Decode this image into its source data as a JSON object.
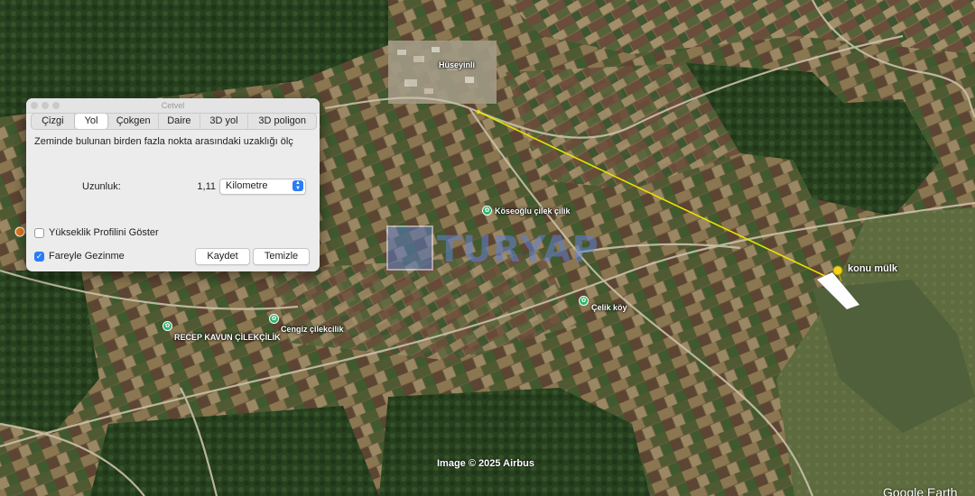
{
  "dialog": {
    "title": "Cetvel",
    "tabs": [
      {
        "label": "Çizgi",
        "active": false
      },
      {
        "label": "Yol",
        "active": true
      },
      {
        "label": "Çokgen",
        "active": false
      },
      {
        "label": "Daire",
        "active": false
      },
      {
        "label": "3D yol",
        "active": false
      },
      {
        "label": "3D poligon",
        "active": false
      }
    ],
    "description": "Zeminde bulunan birden fazla nokta arasındaki uzaklığı ölç",
    "length_label": "Uzunluk:",
    "length_value": "1,11",
    "unit": "Kilometre",
    "elevation_profile_label": "Yükseklik Profilini Göster",
    "elevation_profile_checked": false,
    "mouse_navigation_label": "Fareyle Gezinme",
    "mouse_navigation_checked": true,
    "save_label": "Kaydet",
    "clear_label": "Temizle"
  },
  "map": {
    "labels": {
      "village": "Hüseyinli",
      "kose": "Köseoğlu çilek çilik",
      "celik": "Çelik köy",
      "recep": "RECEP KAVUN ÇİLEKÇİLİK",
      "cengiz": "Cengiz çilekcilik",
      "property": "konu mülk"
    },
    "watermark": "TURYAP",
    "credit": "Image © 2025 Airbus",
    "provider": "Google Earth",
    "colors": {
      "measure_line": "#e8e400",
      "property_pin": "#f2d21a",
      "poi": "#2fb36a"
    }
  }
}
